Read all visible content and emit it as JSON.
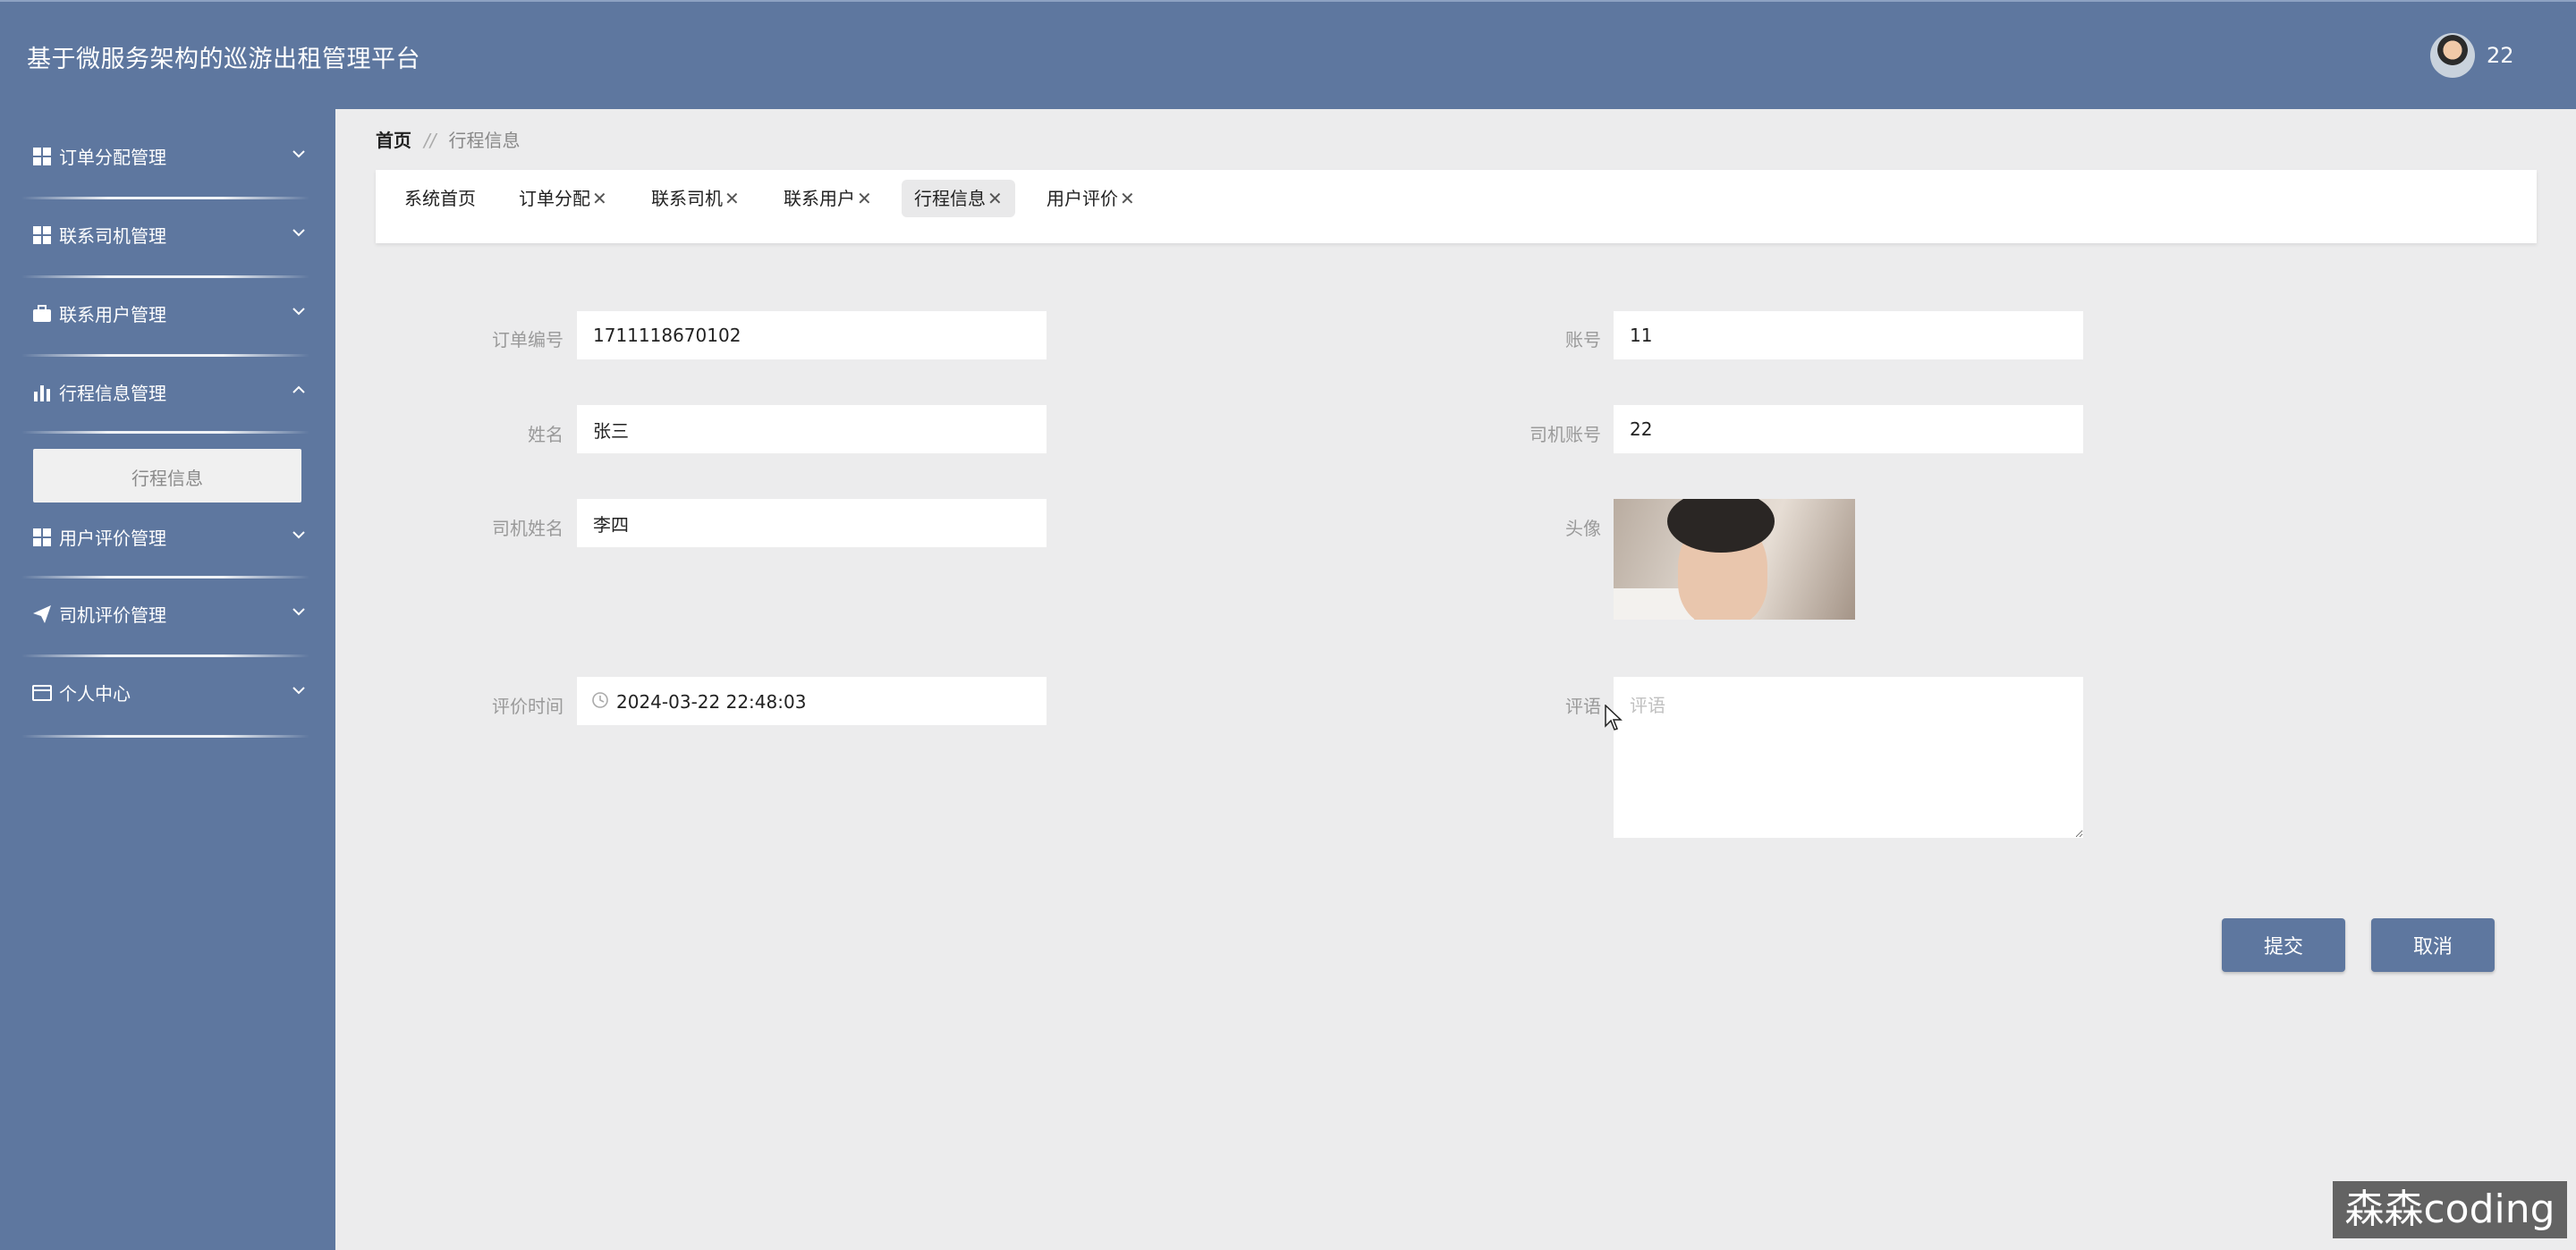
{
  "header": {
    "app_title": "基于微服务架构的巡游出租管理平台",
    "username": "22"
  },
  "sidebar": {
    "items": [
      {
        "label": "订单分配管理",
        "icon": "grid-icon",
        "expanded": false
      },
      {
        "label": "联系司机管理",
        "icon": "grid-icon",
        "expanded": false
      },
      {
        "label": "联系用户管理",
        "icon": "briefcase-icon",
        "expanded": false
      },
      {
        "label": "行程信息管理",
        "icon": "bar-chart-icon",
        "expanded": true
      },
      {
        "label": "用户评价管理",
        "icon": "grid-icon",
        "expanded": false
      },
      {
        "label": "司机评价管理",
        "icon": "paper-plane-icon",
        "expanded": false
      },
      {
        "label": "个人中心",
        "icon": "card-icon",
        "expanded": false
      }
    ],
    "submenu": {
      "label": "行程信息"
    }
  },
  "breadcrumb": {
    "home": "首页",
    "separator": "//",
    "current": "行程信息"
  },
  "tabs": [
    {
      "label": "系统首页",
      "closable": false,
      "active": false
    },
    {
      "label": "订单分配",
      "closable": true,
      "active": false
    },
    {
      "label": "联系司机",
      "closable": true,
      "active": false
    },
    {
      "label": "联系用户",
      "closable": true,
      "active": false
    },
    {
      "label": "行程信息",
      "closable": true,
      "active": true
    },
    {
      "label": "用户评价",
      "closable": true,
      "active": false
    }
  ],
  "form": {
    "order_no": {
      "label": "订单编号",
      "value": "1711118670102"
    },
    "account": {
      "label": "账号",
      "value": "11"
    },
    "name": {
      "label": "姓名",
      "value": "张三"
    },
    "driver_account": {
      "label": "司机账号",
      "value": "22"
    },
    "driver_name": {
      "label": "司机姓名",
      "value": "李四"
    },
    "avatar": {
      "label": "头像"
    },
    "review_time": {
      "label": "评价时间",
      "value": "2024-03-22 22:48:03"
    },
    "comment": {
      "label": "评语",
      "placeholder": "评语",
      "value": ""
    }
  },
  "buttons": {
    "submit": "提交",
    "cancel": "取消"
  },
  "watermark": "森森coding",
  "colors": {
    "primary": "#5e779f",
    "background": "#ececed"
  }
}
